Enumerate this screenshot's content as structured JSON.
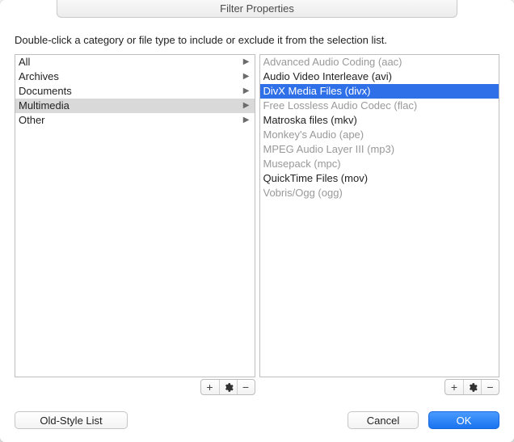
{
  "window": {
    "title": "Filter Properties"
  },
  "instruction": "Double-click a category or file type to include or exclude it from the selection list.",
  "categories": {
    "items": [
      {
        "label": "All",
        "selected": false
      },
      {
        "label": "Archives",
        "selected": false
      },
      {
        "label": "Documents",
        "selected": false
      },
      {
        "label": "Multimedia",
        "selected": true
      },
      {
        "label": "Other",
        "selected": false
      }
    ]
  },
  "filetypes": {
    "items": [
      {
        "label": "Advanced Audio Coding (aac)",
        "muted": true,
        "selected": false
      },
      {
        "label": "Audio Video Interleave (avi)",
        "muted": false,
        "selected": false
      },
      {
        "label": "DivX Media Files (divx)",
        "muted": false,
        "selected": true
      },
      {
        "label": "Free Lossless Audio Codec (flac)",
        "muted": true,
        "selected": false
      },
      {
        "label": "Matroska files (mkv)",
        "muted": false,
        "selected": false
      },
      {
        "label": "Monkey's Audio (ape)",
        "muted": true,
        "selected": false
      },
      {
        "label": "MPEG Audio Layer III (mp3)",
        "muted": true,
        "selected": false
      },
      {
        "label": "Musepack (mpc)",
        "muted": true,
        "selected": false
      },
      {
        "label": "QuickTime Files (mov)",
        "muted": false,
        "selected": false
      },
      {
        "label": "Vobris/Ogg (ogg)",
        "muted": true,
        "selected": false
      }
    ]
  },
  "controls": {
    "add": "+",
    "remove": "−"
  },
  "buttons": {
    "old_style": "Old-Style List",
    "cancel": "Cancel",
    "ok": "OK"
  }
}
